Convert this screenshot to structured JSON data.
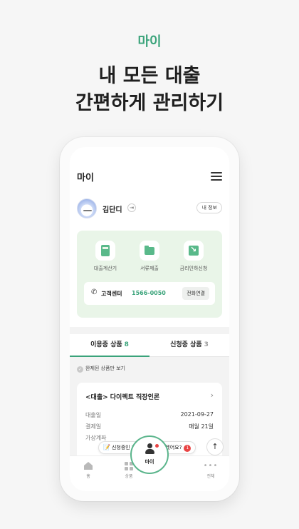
{
  "promo": {
    "tag": "마이",
    "headline_line1": "내 모든 대출",
    "headline_line2": "간편하게 관리하기"
  },
  "app": {
    "title": "마이",
    "profile": {
      "name": "김단디",
      "my_info_label": "내 정보"
    },
    "quick_actions": [
      {
        "label": "대출계산기",
        "icon": "calculator-icon"
      },
      {
        "label": "서류제출",
        "icon": "folder-icon"
      },
      {
        "label": "금리인하신청",
        "icon": "rate-down-icon"
      }
    ],
    "customer_center": {
      "label": "고객센터",
      "number": "1566-0050",
      "call_label": "전화연결"
    },
    "tabs": [
      {
        "label": "이용중 상품",
        "count": "8",
        "active": true
      },
      {
        "label": "신청중 상품",
        "count": "3",
        "active": false
      }
    ],
    "filter_label": "완제된 상품만 보기",
    "loan_card": {
      "title": "<대출> 다이렉트 직장인론",
      "rows": [
        {
          "label": "대출일",
          "value": "2021-09-27"
        },
        {
          "label": "결제일",
          "value": "매월 21일"
        },
        {
          "label": "가상계좌",
          "value": ""
        }
      ]
    },
    "toast": {
      "text": "신청중인 대출을 이어하시겠어요?",
      "badge": "1"
    },
    "bottom_nav": [
      {
        "label": "홈",
        "icon": "home-icon"
      },
      {
        "label": "상품",
        "icon": "grid-icon"
      },
      {
        "label": "마이",
        "icon": "person-icon"
      },
      {
        "label": "전체",
        "icon": "more-icon"
      }
    ],
    "accent_color": "#3aa37a",
    "panel_color": "#e9f5e8"
  }
}
